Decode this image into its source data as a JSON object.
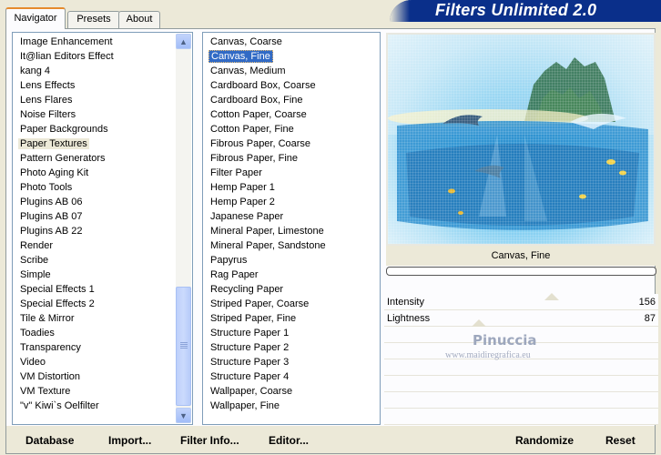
{
  "window": {
    "title": "Filters Unlimited 2.0"
  },
  "tabs": [
    {
      "label": "Navigator",
      "active": true
    },
    {
      "label": "Presets",
      "active": false
    },
    {
      "label": "About",
      "active": false
    }
  ],
  "categories": {
    "items": [
      "Image Enhancement",
      "It@lian Editors Effect",
      "kang 4",
      "Lens Effects",
      "Lens Flares",
      "Noise Filters",
      "Paper Backgrounds",
      "Paper Textures",
      "Pattern Generators",
      "Photo Aging Kit",
      "Photo Tools",
      "Plugins AB 06",
      "Plugins AB 07",
      "Plugins AB 22",
      "Render",
      "Scribe",
      "Simple",
      "Special Effects 1",
      "Special Effects 2",
      "Tile & Mirror",
      "Toadies",
      "Transparency",
      "Video",
      "VM Distortion",
      "VM Texture",
      "\"v\" Kiwi`s Oelfilter"
    ],
    "selected": "Paper Textures"
  },
  "filters": {
    "items": [
      "Canvas, Coarse",
      "Canvas, Fine",
      "Canvas, Medium",
      "Cardboard Box, Coarse",
      "Cardboard Box, Fine",
      "Cotton Paper, Coarse",
      "Cotton Paper, Fine",
      "Fibrous Paper, Coarse",
      "Fibrous Paper, Fine",
      "Filter Paper",
      "Hemp Paper 1",
      "Hemp Paper 2",
      "Japanese Paper",
      "Mineral Paper, Limestone",
      "Mineral Paper, Sandstone",
      "Papyrus",
      "Rag Paper",
      "Recycling Paper",
      "Striped Paper, Coarse",
      "Striped Paper, Fine",
      "Structure Paper 1",
      "Structure Paper 2",
      "Structure Paper 3",
      "Structure Paper 4",
      "Wallpaper, Coarse",
      "Wallpaper, Fine"
    ],
    "selected": "Canvas, Fine"
  },
  "preview": {
    "filter_name": "Canvas, Fine",
    "progress": 0
  },
  "params": [
    {
      "label": "Intensity",
      "value": "156"
    },
    {
      "label": "Lightness",
      "value": "87"
    }
  ],
  "watermark": {
    "name": "Pinuccia",
    "url": "www.maidiregrafica.eu"
  },
  "buttons": {
    "database": "Database",
    "import": "Import...",
    "filter_info": "Filter Info...",
    "editor": "Editor...",
    "randomize": "Randomize",
    "reset": "Reset"
  },
  "colors": {
    "selection": "#316ac5",
    "title_bar": "#0a2f8a",
    "panel_bg": "#ece9d8"
  }
}
